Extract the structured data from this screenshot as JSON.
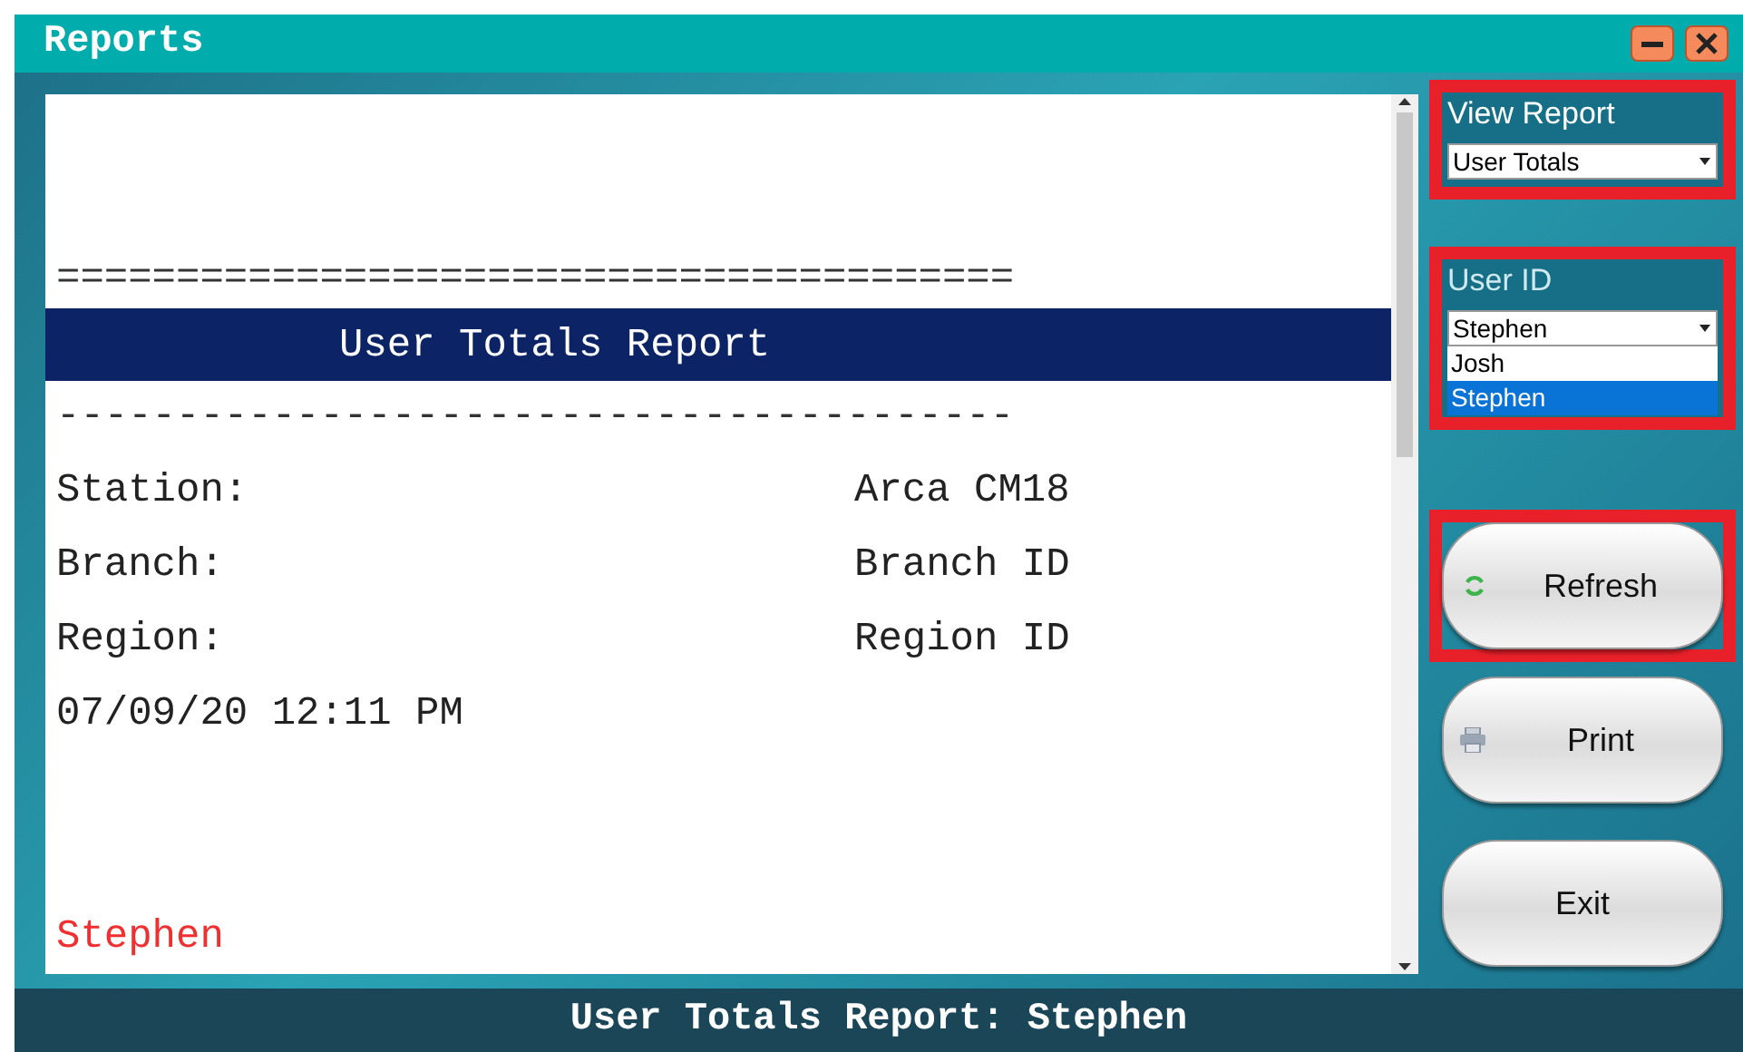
{
  "window": {
    "title": "Reports"
  },
  "report": {
    "separator_double": "========================================",
    "header": "User Totals Report",
    "separator_single": "----------------------------------------",
    "fields": [
      {
        "label": "Station:",
        "value": "Arca CM18"
      },
      {
        "label": "Branch:",
        "value": "Branch ID"
      },
      {
        "label": "Region:",
        "value": "Region ID"
      }
    ],
    "timestamp": "07/09/20 12:11 PM",
    "user": "Stephen"
  },
  "view_report": {
    "label": "View Report",
    "value": "User Totals",
    "highlighted": true
  },
  "user_id": {
    "label": "User ID",
    "value": "Stephen",
    "highlighted": true,
    "options": [
      {
        "label": "Josh",
        "selected": false
      },
      {
        "label": "Stephen",
        "selected": true
      }
    ]
  },
  "buttons": [
    {
      "kind": "refresh",
      "label": "Refresh",
      "highlighted": true
    },
    {
      "kind": "print",
      "label": "Print",
      "highlighted": false
    },
    {
      "kind": "exit",
      "label": "Exit",
      "highlighted": false
    }
  ],
  "status_bar": "User Totals Report: Stephen"
}
